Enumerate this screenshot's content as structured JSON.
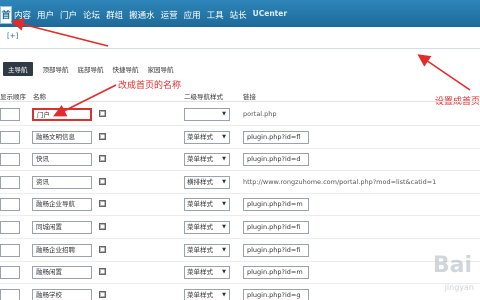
{
  "topbar": {
    "home_label": "首",
    "nav": [
      "内容",
      "用户",
      "门户",
      "论坛",
      "群组",
      "搬通水",
      "运营",
      "应用",
      "工具",
      "站长",
      "UCenter"
    ]
  },
  "subbar": {
    "plus_label": "[+]"
  },
  "tabs": [
    "主导航",
    "顶部导航",
    "底部导航",
    "快捷导航",
    "家园导航"
  ],
  "annotations": {
    "rename": "改成首页的名称",
    "set_home": "设置成首页"
  },
  "table": {
    "headers": [
      "显示顺序",
      "名称",
      "二级导航样式",
      "链接"
    ],
    "rows": [
      {
        "name": "门户",
        "style": "",
        "link": "portal.php",
        "link_boxed": false,
        "highlight": true
      },
      {
        "name": "融畅文明信息",
        "style": "菜单样式",
        "link": "plugin.php?id=fl",
        "link_boxed": true,
        "highlight": false
      },
      {
        "name": "快讯",
        "style": "菜单样式",
        "link": "plugin.php?id=d",
        "link_boxed": true,
        "highlight": false
      },
      {
        "name": "资讯",
        "style": "横排样式",
        "link": "http://www.rongzuhome.com/portal.php?mod=list&catid=1",
        "link_boxed": false,
        "highlight": false
      },
      {
        "name": "融畅企业导航",
        "style": "菜单样式",
        "link": "plugin.php?id=m",
        "link_boxed": true,
        "highlight": false
      },
      {
        "name": "同城闲置",
        "style": "菜单样式",
        "link": "plugin.php?id=fi",
        "link_boxed": true,
        "highlight": false
      },
      {
        "name": "融畅企业招聘",
        "style": "菜单样式",
        "link": "plugin.php?id=fi",
        "link_boxed": true,
        "highlight": false
      },
      {
        "name": "融畅闲置",
        "style": "菜单样式",
        "link": "plugin.php?id=m",
        "link_boxed": true,
        "highlight": false
      },
      {
        "name": "融畅学校",
        "style": "菜单样式",
        "link": "plugin.php?id=g",
        "link_boxed": true,
        "highlight": false
      }
    ]
  },
  "watermark": {
    "main": "Bai",
    "sub": "jingyan"
  },
  "colors": {
    "accent": "#1d6a99",
    "annotation": "#e22b2b"
  }
}
